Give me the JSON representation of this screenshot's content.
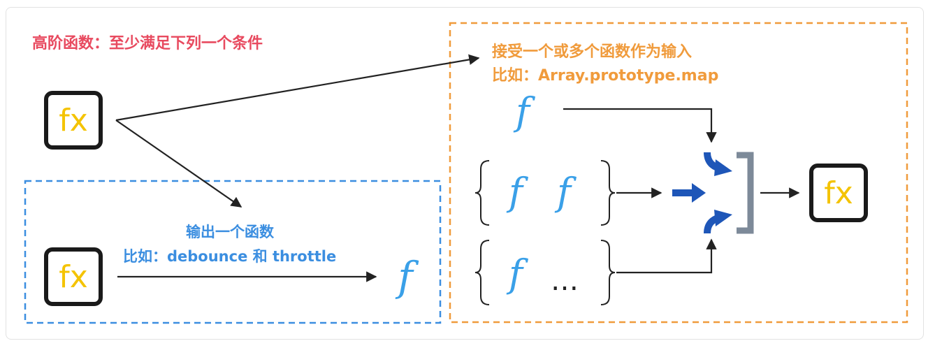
{
  "title": "高阶函数：至少满足下列一个条件",
  "input_case": {
    "heading": "接受一个或多个函数作为输入",
    "example": "比如：Array.prototype.map"
  },
  "output_case": {
    "heading": "输出一个函数",
    "example": "比如：debounce 和 throttle"
  },
  "fx_label": "fx",
  "f_symbol": "f",
  "ellipsis": "…",
  "colors": {
    "title": "#e84a5f",
    "input_box": "#f09b3c",
    "output_box": "#3b8ee0",
    "fx_text": "#f4c300",
    "f_symbol": "#3aa0e8",
    "merge_icon": "#1e56b8"
  },
  "icons": [
    "fx-icon",
    "merge-arrows-icon"
  ]
}
